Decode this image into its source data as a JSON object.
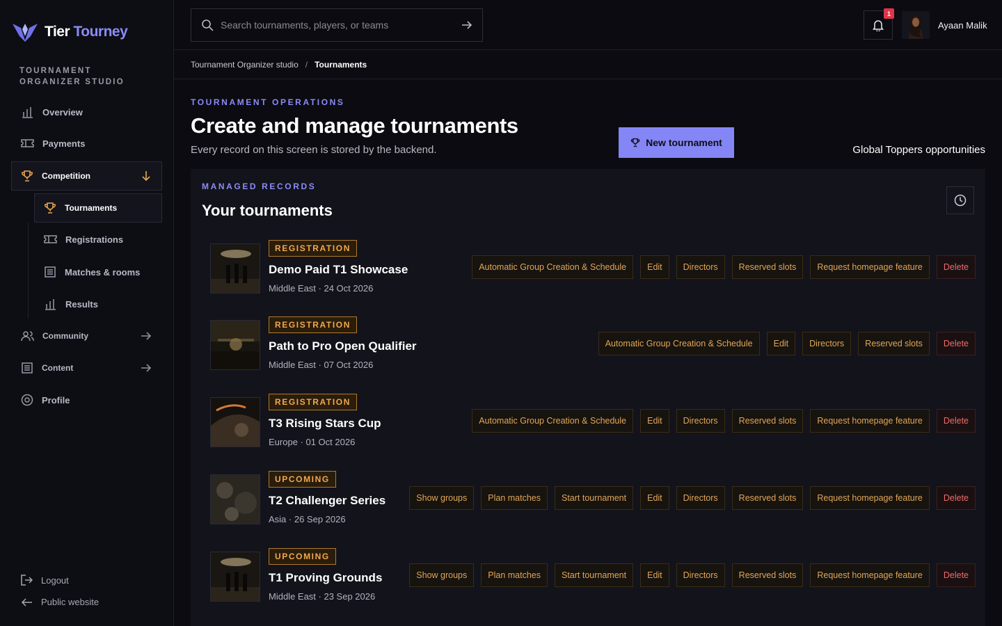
{
  "brand": {
    "word1": "Tier",
    "word2": "Tourney"
  },
  "sidebar": {
    "section_label": "TOURNAMENT ORGANIZER STUDIO",
    "items": [
      {
        "label": "Overview",
        "icon": "bar-chart-icon"
      },
      {
        "label": "Payments",
        "icon": "ticket-icon"
      },
      {
        "label": "Competition",
        "icon": "trophy-icon",
        "expanded": true
      },
      {
        "label": "Community",
        "icon": "users-icon"
      },
      {
        "label": "Content",
        "icon": "list-icon"
      },
      {
        "label": "Profile",
        "icon": "target-icon"
      }
    ],
    "subitems": [
      {
        "label": "Tournaments",
        "icon": "trophy-icon",
        "active": true
      },
      {
        "label": "Registrations",
        "icon": "ticket-icon"
      },
      {
        "label": "Matches & rooms",
        "icon": "list-icon"
      },
      {
        "label": "Results",
        "icon": "bar-chart-icon"
      }
    ],
    "logout": "Logout",
    "public_website": "Public website"
  },
  "topbar": {
    "search_placeholder": "Search tournaments, players, or teams",
    "notification_count": "1",
    "user_name": "Ayaan Malik"
  },
  "breadcrumb": {
    "parent": "Tournament Organizer studio",
    "separator": "/",
    "current": "Tournaments"
  },
  "header": {
    "eyebrow": "TOURNAMENT OPERATIONS",
    "title": "Create and manage tournaments",
    "subtitle": "Every record on this screen is stored by the backend.",
    "new_button": "New tournament",
    "global_link": "Global Toppers opportunities"
  },
  "panel": {
    "eyebrow": "MANAGED RECORDS",
    "title": "Your tournaments"
  },
  "tournaments": [
    {
      "status": "REGISTRATION",
      "name": "Demo Paid T1 Showcase",
      "meta": "Middle East · 24 Oct 2026",
      "actions": [
        "Automatic Group Creation & Schedule",
        "Edit",
        "Directors",
        "Reserved slots",
        "Request homepage feature",
        "Delete"
      ]
    },
    {
      "status": "REGISTRATION",
      "name": "Path to Pro Open Qualifier",
      "meta": "Middle East · 07 Oct 2026",
      "actions": [
        "Automatic Group Creation & Schedule",
        "Edit",
        "Directors",
        "Reserved slots",
        "Delete"
      ]
    },
    {
      "status": "REGISTRATION",
      "name": "T3 Rising Stars Cup",
      "meta": "Europe · 01 Oct 2026",
      "actions": [
        "Automatic Group Creation & Schedule",
        "Edit",
        "Directors",
        "Reserved slots",
        "Request homepage feature",
        "Delete"
      ]
    },
    {
      "status": "UPCOMING",
      "name": "T2 Challenger Series",
      "meta": "Asia · 26 Sep 2026",
      "actions": [
        "Show groups",
        "Plan matches",
        "Start tournament",
        "Edit",
        "Directors",
        "Reserved slots",
        "Request homepage feature",
        "Delete"
      ]
    },
    {
      "status": "UPCOMING",
      "name": "T1 Proving Grounds",
      "meta": "Middle East · 23 Sep 2026",
      "actions": [
        "Show groups",
        "Plan matches",
        "Start tournament",
        "Edit",
        "Directors",
        "Reserved slots",
        "Request homepage feature",
        "Delete"
      ]
    }
  ],
  "colors": {
    "accent": "#8b8cf7",
    "status": "#f0a850",
    "danger": "#f06a6a",
    "background": "#0b0b11",
    "panel": "#13131b"
  }
}
